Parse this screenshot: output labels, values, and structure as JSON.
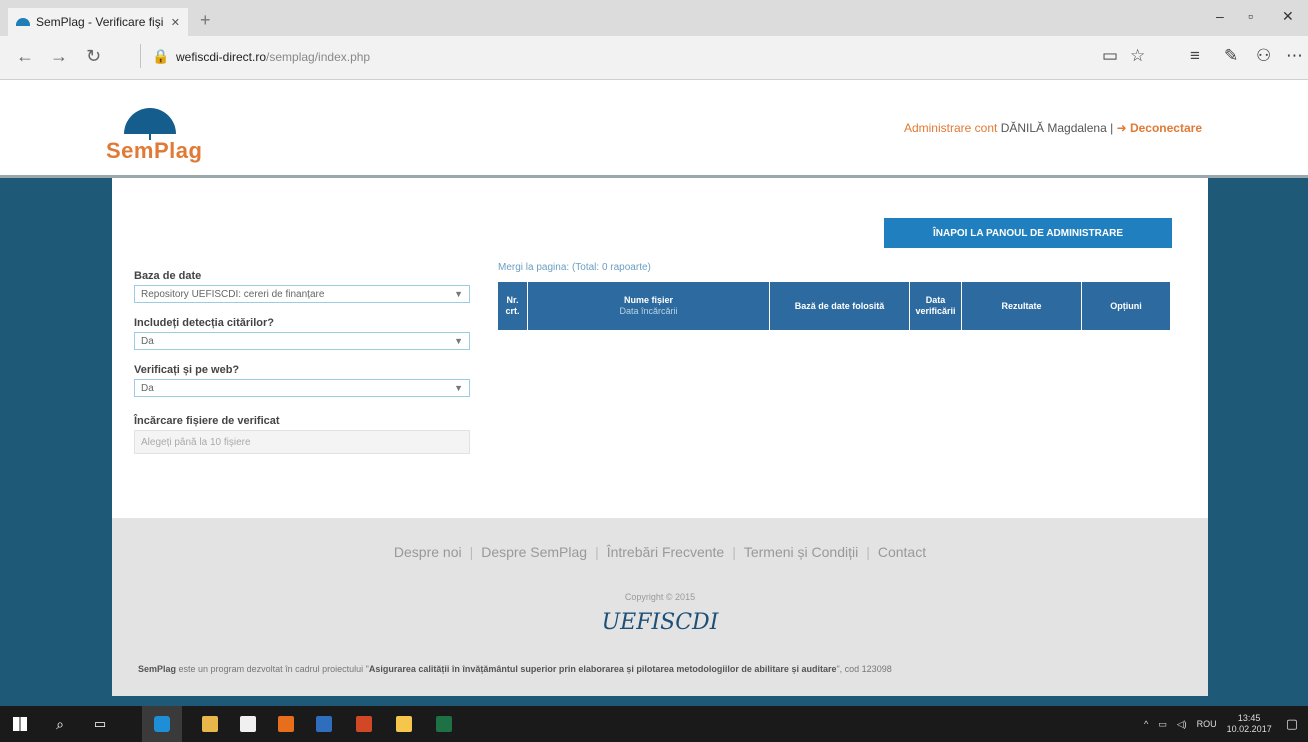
{
  "browser": {
    "tab_title": "SemPlag - Verificare fişi",
    "url_domain": "wefiscdi-direct.ro",
    "url_path": "/semplag/index.php",
    "icons": [
      "back-icon",
      "forward-icon",
      "refresh-icon",
      "lock-icon",
      "reading-view-icon",
      "favorite-icon",
      "hub-icon",
      "note-icon",
      "share-icon",
      "more-icon"
    ]
  },
  "header": {
    "logo_text": "SemPlag",
    "admin_link": "Administrare cont",
    "user_name": "DĂNILĂ Magdalena",
    "logout_label": "Deconectare"
  },
  "main": {
    "back_button_label": "ÎNAPOI LA PANOUL DE ADMINISTRARE",
    "form": {
      "db_label": "Baza de date",
      "db_value": "Repository UEFISCDI: cereri de finanțare",
      "citations_label": "Includeți detecția citărilor?",
      "citations_value": "Da",
      "web_label": "Verificați și pe web?",
      "web_value": "Da",
      "upload_label": "Încărcare fișiere de verificat",
      "upload_placeholder": "Alegeți până la 10 fișiere"
    },
    "goto_label": "Mergi la pagina:",
    "total_label": "(Total: 0 rapoarte)",
    "table": {
      "columns": [
        {
          "label": "Nr. crt."
        },
        {
          "label": "Nume fișier",
          "sub": "Data încărcării"
        },
        {
          "label": "Bază de date folosită"
        },
        {
          "label": "Data verificării"
        },
        {
          "label": "Rezultate"
        },
        {
          "label": "Opțiuni"
        }
      ]
    }
  },
  "footer": {
    "links": [
      "Despre noi",
      "Despre SemPlag",
      "Întrebări Frecvente",
      "Termeni și Condiții",
      "Contact"
    ],
    "copyright": "Copyright © 2015",
    "logo_text": "UEFISCDI",
    "about_prefix": "SemPlag",
    "about_text": " este un program dezvoltat în cadrul proiectului \"",
    "about_project": "Asigurarea calității în învățământul superior prin elaborarea și pilotarea metodologiilor de abilitare și auditare",
    "about_suffix": "\", cod 123098"
  },
  "taskbar": {
    "icons": [
      "windows-start-icon",
      "search-icon",
      "task-view-icon",
      "edge-icon",
      "file-explorer-icon",
      "store-icon",
      "office-icon",
      "outlook-icon",
      "powerpoint-icon",
      "folder-icon",
      "excel-icon"
    ],
    "lang": "ROU",
    "time": "13:45",
    "date": "10.02.2017"
  }
}
